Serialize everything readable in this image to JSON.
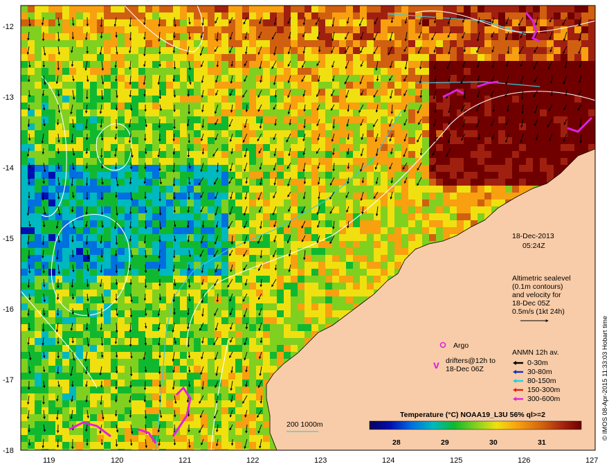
{
  "map": {
    "date": "18-Dec-2013",
    "time": "05:24Z",
    "altimetry": [
      "Altimetric sealevel",
      "(0.1m contours)",
      "and velocity for",
      "18-Dec 05Z",
      "0.5m/s (1kt 24h)"
    ],
    "argo_label": "Argo",
    "drifter_symbol": "v",
    "drifter_label": [
      "drifters@12h to",
      "18-Dec 06Z"
    ],
    "anmn_title": "ANMN 12h av.",
    "anmn_items": [
      {
        "label": "0-30m",
        "color": "#000000"
      },
      {
        "label": "30-80m",
        "color": "#1030c0"
      },
      {
        "label": "80-150m",
        "color": "#20d0e0"
      },
      {
        "label": "150-300m",
        "color": "#e02010"
      },
      {
        "label": "300-600m",
        "color": "#e020e0"
      }
    ],
    "isobath_label": "200  1000m",
    "colorbar_title": "Temperature (°C) NOAA19_L3U 56% ql>=2",
    "colorbar_ticks": [
      "28",
      "29",
      "30",
      "31"
    ],
    "credit": "© IMOS 08-Apr-2015 11:33:03 Hobart time",
    "lon_ticks": [
      "119",
      "120",
      "121",
      "122",
      "123",
      "124",
      "125",
      "126",
      "127"
    ],
    "lat_ticks": [
      "-12",
      "-13",
      "-14",
      "-15",
      "-16",
      "-17",
      "-18"
    ],
    "colors": {
      "land": "#f8cca8",
      "isobath": "#40c8d8",
      "contour": "#ffffff",
      "argo": "#e020e0"
    }
  }
}
